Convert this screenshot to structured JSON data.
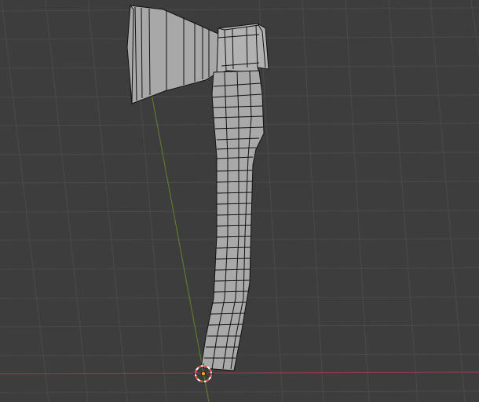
{
  "viewport": {
    "background": "#3d3d3d",
    "grid_color": "#4a4a4a",
    "x_axis_color": "#8a3d47",
    "y_axis_color": "#5c7a2a",
    "cursor_colors": [
      "#e84b4b",
      "#ffffff"
    ]
  },
  "scene": {
    "mesh_object": "axe",
    "mesh_face_color": "#a7a7a7",
    "mesh_edge_color": "#111111",
    "origin_point_color": "#f5a623"
  }
}
